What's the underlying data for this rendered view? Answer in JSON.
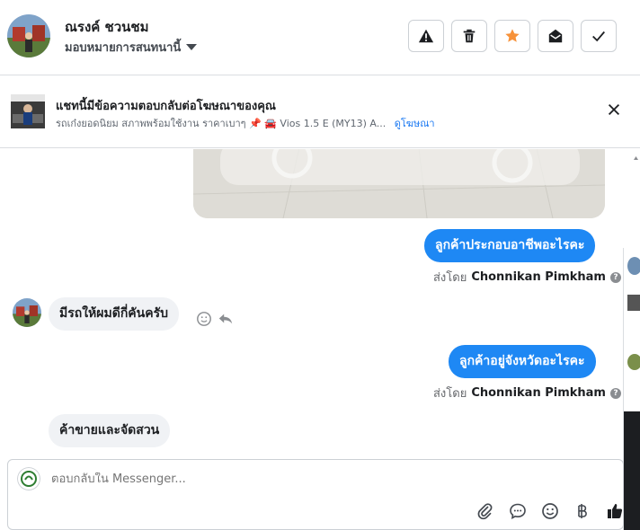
{
  "header": {
    "name": "ณรงค์ ชวนชม",
    "assign_label": "มอบหมายการสนทนานี้"
  },
  "ad": {
    "title": "แชทนี้มีข้อความตอบกลับต่อโฆษณาของคุณ",
    "description": "รถเก๋งยอดนิยม สภาพพร้อมใช้งาน ราคาเบาๆ 📌 🚘 Vios 1.5 E (MY13) A...",
    "link": "ดูโฆษณา"
  },
  "messages": [
    {
      "direction": "out",
      "text": "ลูกค้าประกอบอาชีพอะไรคะ",
      "sent_by_prefix": "ส่งโดย",
      "sent_by_name": "Chonnikan Pimkham"
    },
    {
      "direction": "in",
      "text": "มีรถให้ผมดีกี่คันครับ"
    },
    {
      "direction": "out",
      "text": "ลูกค้าอยู่จังหวัดอะไรคะ",
      "sent_by_prefix": "ส่งโดย",
      "sent_by_name": "Chonnikan Pimkham"
    },
    {
      "direction": "in",
      "text": "ค้าขายและจัดสวน"
    }
  ],
  "composer": {
    "placeholder": "ตอบกลับใน Messenger..."
  },
  "colors": {
    "accent": "#1e88f4",
    "star": "#f7923a"
  }
}
